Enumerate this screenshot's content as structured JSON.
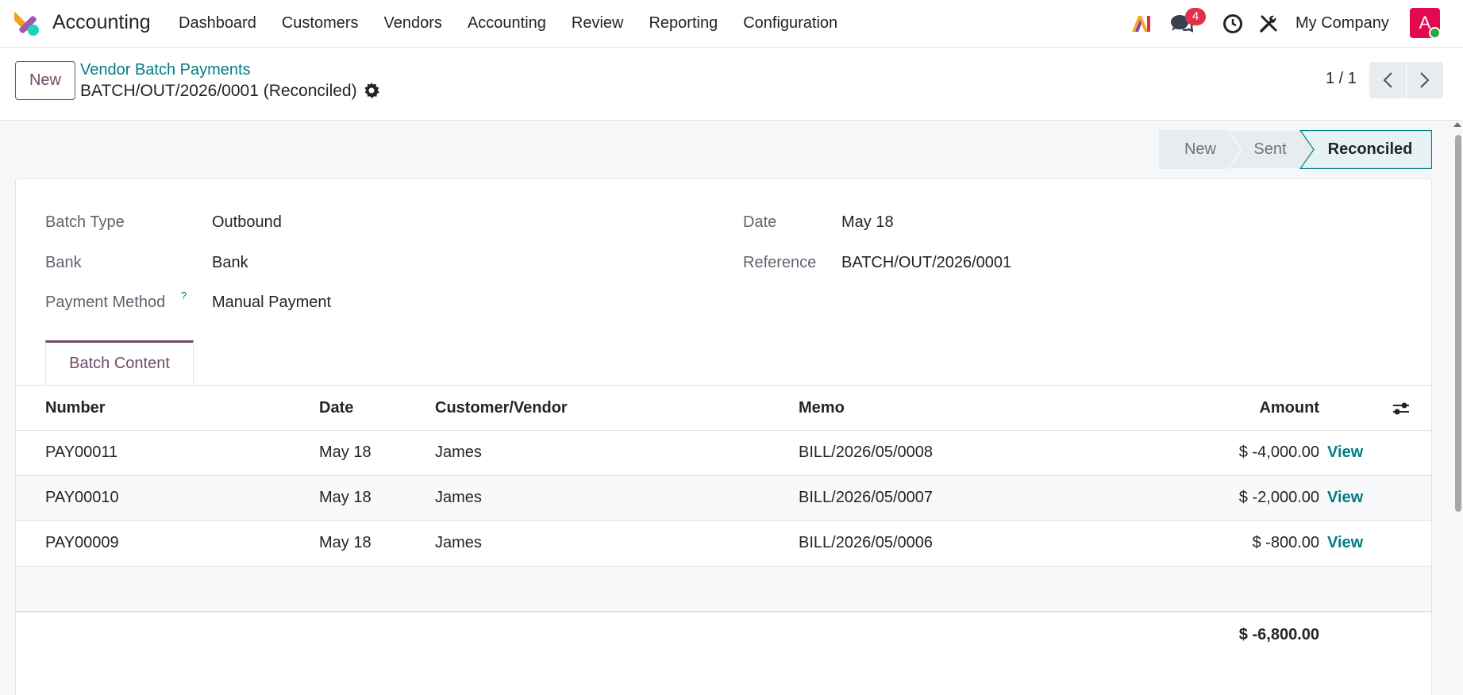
{
  "navbar": {
    "app_name": "Accounting",
    "menu": [
      "Dashboard",
      "Customers",
      "Vendors",
      "Accounting",
      "Review",
      "Reporting",
      "Configuration"
    ],
    "chat_badge_count": "4",
    "company": "My Company",
    "avatar_initial": "A",
    "icons": [
      "accounting-logo-icon",
      "ai-icon",
      "chat-icon",
      "clock-icon",
      "tools-icon"
    ]
  },
  "control_panel": {
    "new_label": "New",
    "breadcrumb": "Vendor Batch Payments",
    "record_title": "BATCH/OUT/2026/0001 (Reconciled)",
    "pager": "1 / 1"
  },
  "statusbar": {
    "stages": [
      "New",
      "Sent",
      "Reconciled"
    ],
    "active": "Reconciled"
  },
  "form": {
    "batch_type_label": "Batch Type",
    "batch_type_value": "Outbound",
    "bank_label": "Bank",
    "bank_value": "Bank",
    "payment_method_label": "Payment Method",
    "payment_method_help": "?",
    "payment_method_value": "Manual Payment",
    "date_label": "Date",
    "date_value": "May 18",
    "reference_label": "Reference",
    "reference_value": "BATCH/OUT/2026/0001"
  },
  "tab": {
    "label": "Batch Content"
  },
  "table": {
    "headers": {
      "number": "Number",
      "date": "Date",
      "partner": "Customer/Vendor",
      "memo": "Memo",
      "amount": "Amount"
    },
    "rows": [
      {
        "number": "PAY00011",
        "date": "May 18",
        "partner": "James",
        "memo": "BILL/2026/05/0008",
        "amount": "$ -4,000.00",
        "action": "View"
      },
      {
        "number": "PAY00010",
        "date": "May 18",
        "partner": "James",
        "memo": "BILL/2026/05/0007",
        "amount": "$ -2,000.00",
        "action": "View"
      },
      {
        "number": "PAY00009",
        "date": "May 18",
        "partner": "James",
        "memo": "BILL/2026/05/0006",
        "amount": "$ -800.00",
        "action": "View"
      }
    ],
    "total": "$ -6,800.00"
  },
  "colors": {
    "brand": "#714b67",
    "link": "#017e84",
    "badge": "#e0314b",
    "avatar": "#e2094f"
  }
}
